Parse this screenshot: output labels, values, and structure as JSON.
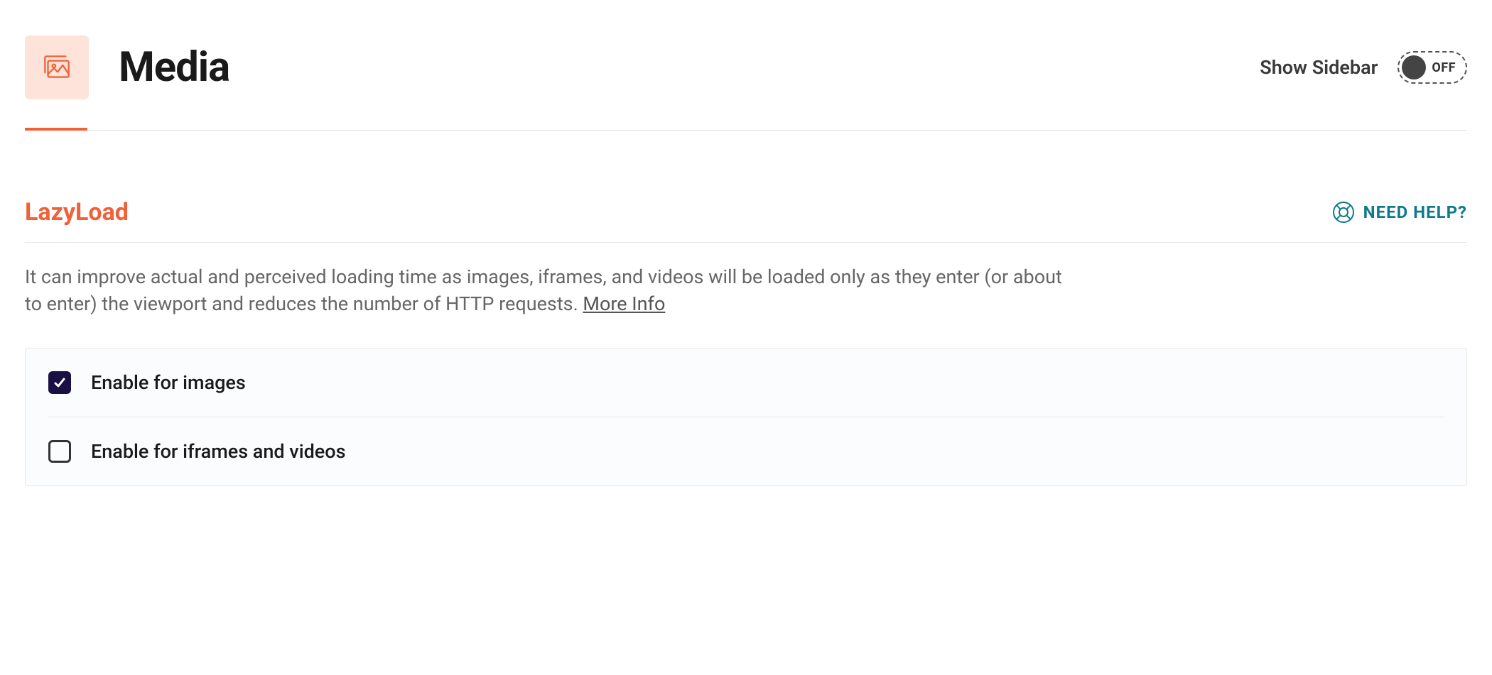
{
  "header": {
    "title": "Media",
    "sidebar_label": "Show Sidebar",
    "toggle_state": "OFF"
  },
  "section": {
    "title": "LazyLoad",
    "help_label": "NEED HELP?",
    "description_part1": "It can improve actual and perceived loading time as images, iframes, and videos will be loaded only as they enter (or about to enter) the viewport and reduces the number of HTTP requests. ",
    "more_info_label": "More Info"
  },
  "options": [
    {
      "label": "Enable for images",
      "checked": true
    },
    {
      "label": "Enable for iframes and videos",
      "checked": false
    }
  ],
  "colors": {
    "accent": "#f06139",
    "teal": "#0f7b8a",
    "dark_purple": "#1a1044"
  }
}
